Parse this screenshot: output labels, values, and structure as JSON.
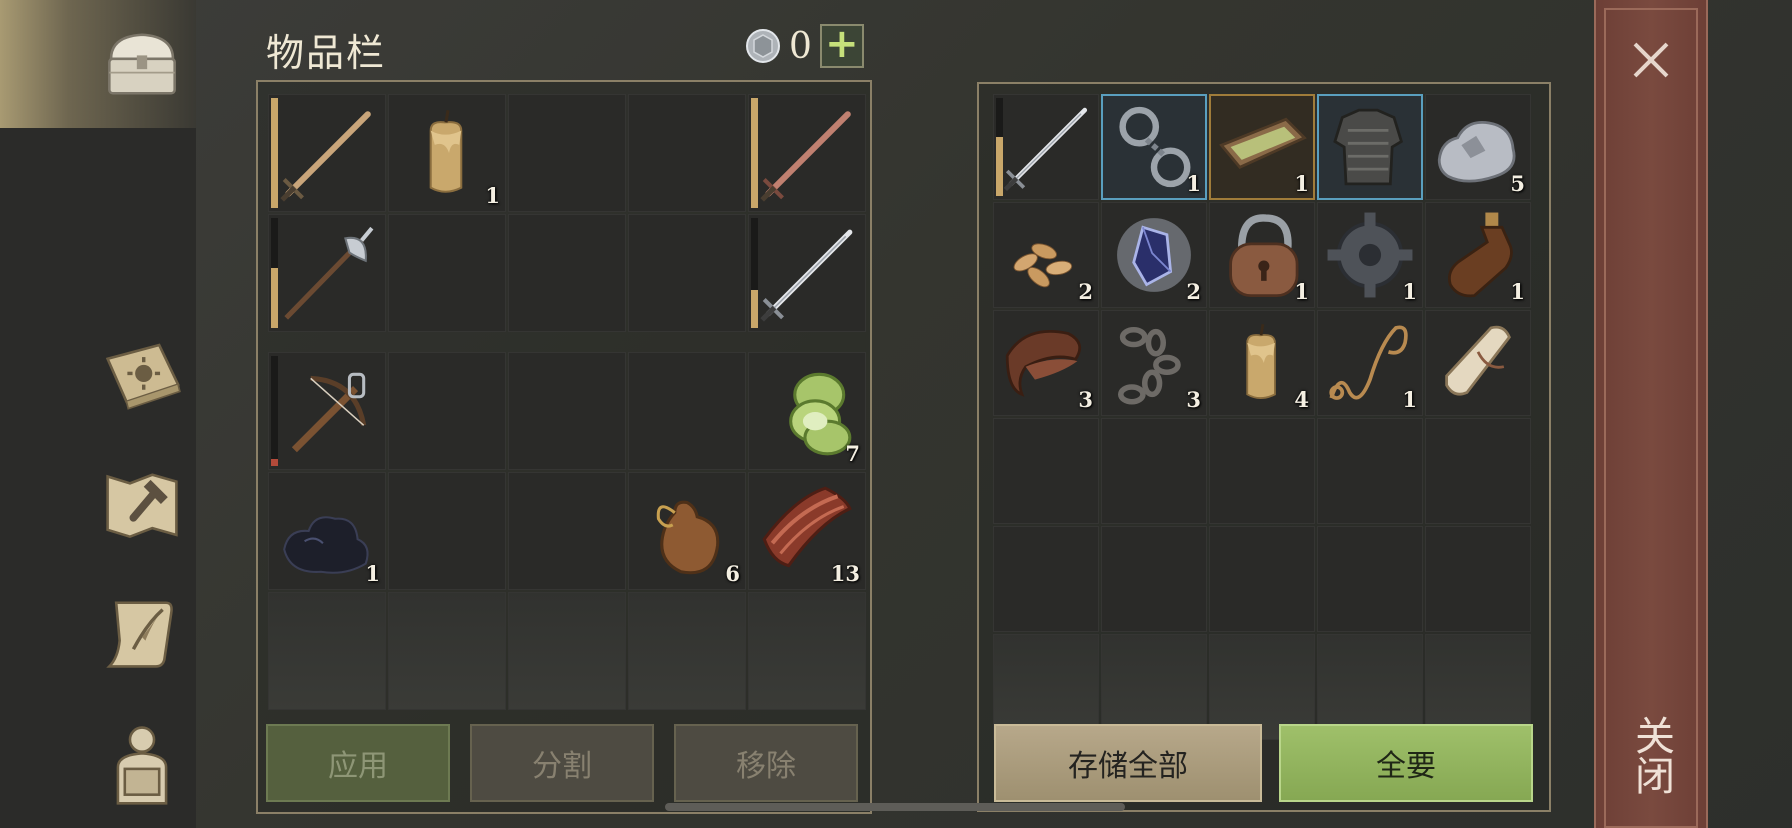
{
  "title": "物品栏",
  "currency": {
    "value": "0",
    "add_label": "+"
  },
  "colors": {
    "accent_green": "#9fc06a",
    "tan": "#b7a88a",
    "close_panel": "#6d3f36",
    "rare_blue": "#5a9fbf",
    "rare_gold": "#a07c3a"
  },
  "nav": [
    {
      "name": "chest-icon",
      "active": true
    },
    {
      "name": "book-sun-icon"
    },
    {
      "name": "map-hammer-icon"
    },
    {
      "name": "scroll-quill-icon"
    },
    {
      "name": "backpack-character-icon"
    }
  ],
  "inventory": {
    "quick": [
      {
        "icon": "sword-icon",
        "durability": 1.0
      },
      {
        "icon": "candle-icon",
        "qty": "1"
      },
      {},
      {},
      {
        "icon": "copper-sword-icon",
        "durability": 1.0
      },
      {
        "icon": "halberd-icon",
        "durability": 0.55
      },
      {},
      {},
      {},
      {
        "icon": "steel-sword-icon",
        "durability": 0.35
      }
    ],
    "bag": [
      {
        "icon": "crossbow-icon",
        "durability": 0.06,
        "durability_low": true
      },
      {},
      {},
      {},
      {
        "icon": "cucumber-slices-icon",
        "qty": "7"
      },
      {
        "icon": "coal-icon",
        "qty": "1"
      },
      {},
      {},
      {
        "icon": "waterskin-icon",
        "qty": "6"
      },
      {
        "icon": "bacon-icon",
        "qty": "13"
      },
      {
        "faded": true
      },
      {
        "faded": true
      },
      {
        "faded": true
      },
      {
        "faded": true
      },
      {
        "faded": true
      }
    ],
    "buttons": {
      "apply": "应用",
      "split": "分割",
      "remove": "移除"
    }
  },
  "storage": {
    "slots": [
      {
        "icon": "steel-sword-icon",
        "durability": 0.6
      },
      {
        "icon": "shackles-icon",
        "qty": "1",
        "rarity": "blue"
      },
      {
        "icon": "tray-icon",
        "qty": "1",
        "rarity": "gold"
      },
      {
        "icon": "chainmail-icon",
        "rarity": "blue"
      },
      {
        "icon": "ore-icon",
        "qty": "5"
      },
      {
        "icon": "seeds-icon",
        "qty": "2"
      },
      {
        "icon": "crystal-icon",
        "qty": "2"
      },
      {
        "icon": "padlock-icon",
        "qty": "1"
      },
      {
        "icon": "gear-icon",
        "qty": "1"
      },
      {
        "icon": "bottle-icon",
        "qty": "1"
      },
      {
        "icon": "leather-icon",
        "qty": "3"
      },
      {
        "icon": "chain-icon",
        "qty": "3"
      },
      {
        "icon": "candle-icon",
        "qty": "4"
      },
      {
        "icon": "rope-icon",
        "qty": "1"
      },
      {
        "icon": "scroll-icon"
      },
      {},
      {},
      {},
      {},
      {},
      {},
      {},
      {},
      {},
      {},
      {
        "faded": true
      },
      {
        "faded": true
      },
      {
        "faded": true
      },
      {
        "faded": true
      },
      {
        "faded": true
      }
    ],
    "buttons": {
      "store_all": "存储全部",
      "take_all": "全要"
    }
  },
  "close": {
    "label": "关闭"
  }
}
